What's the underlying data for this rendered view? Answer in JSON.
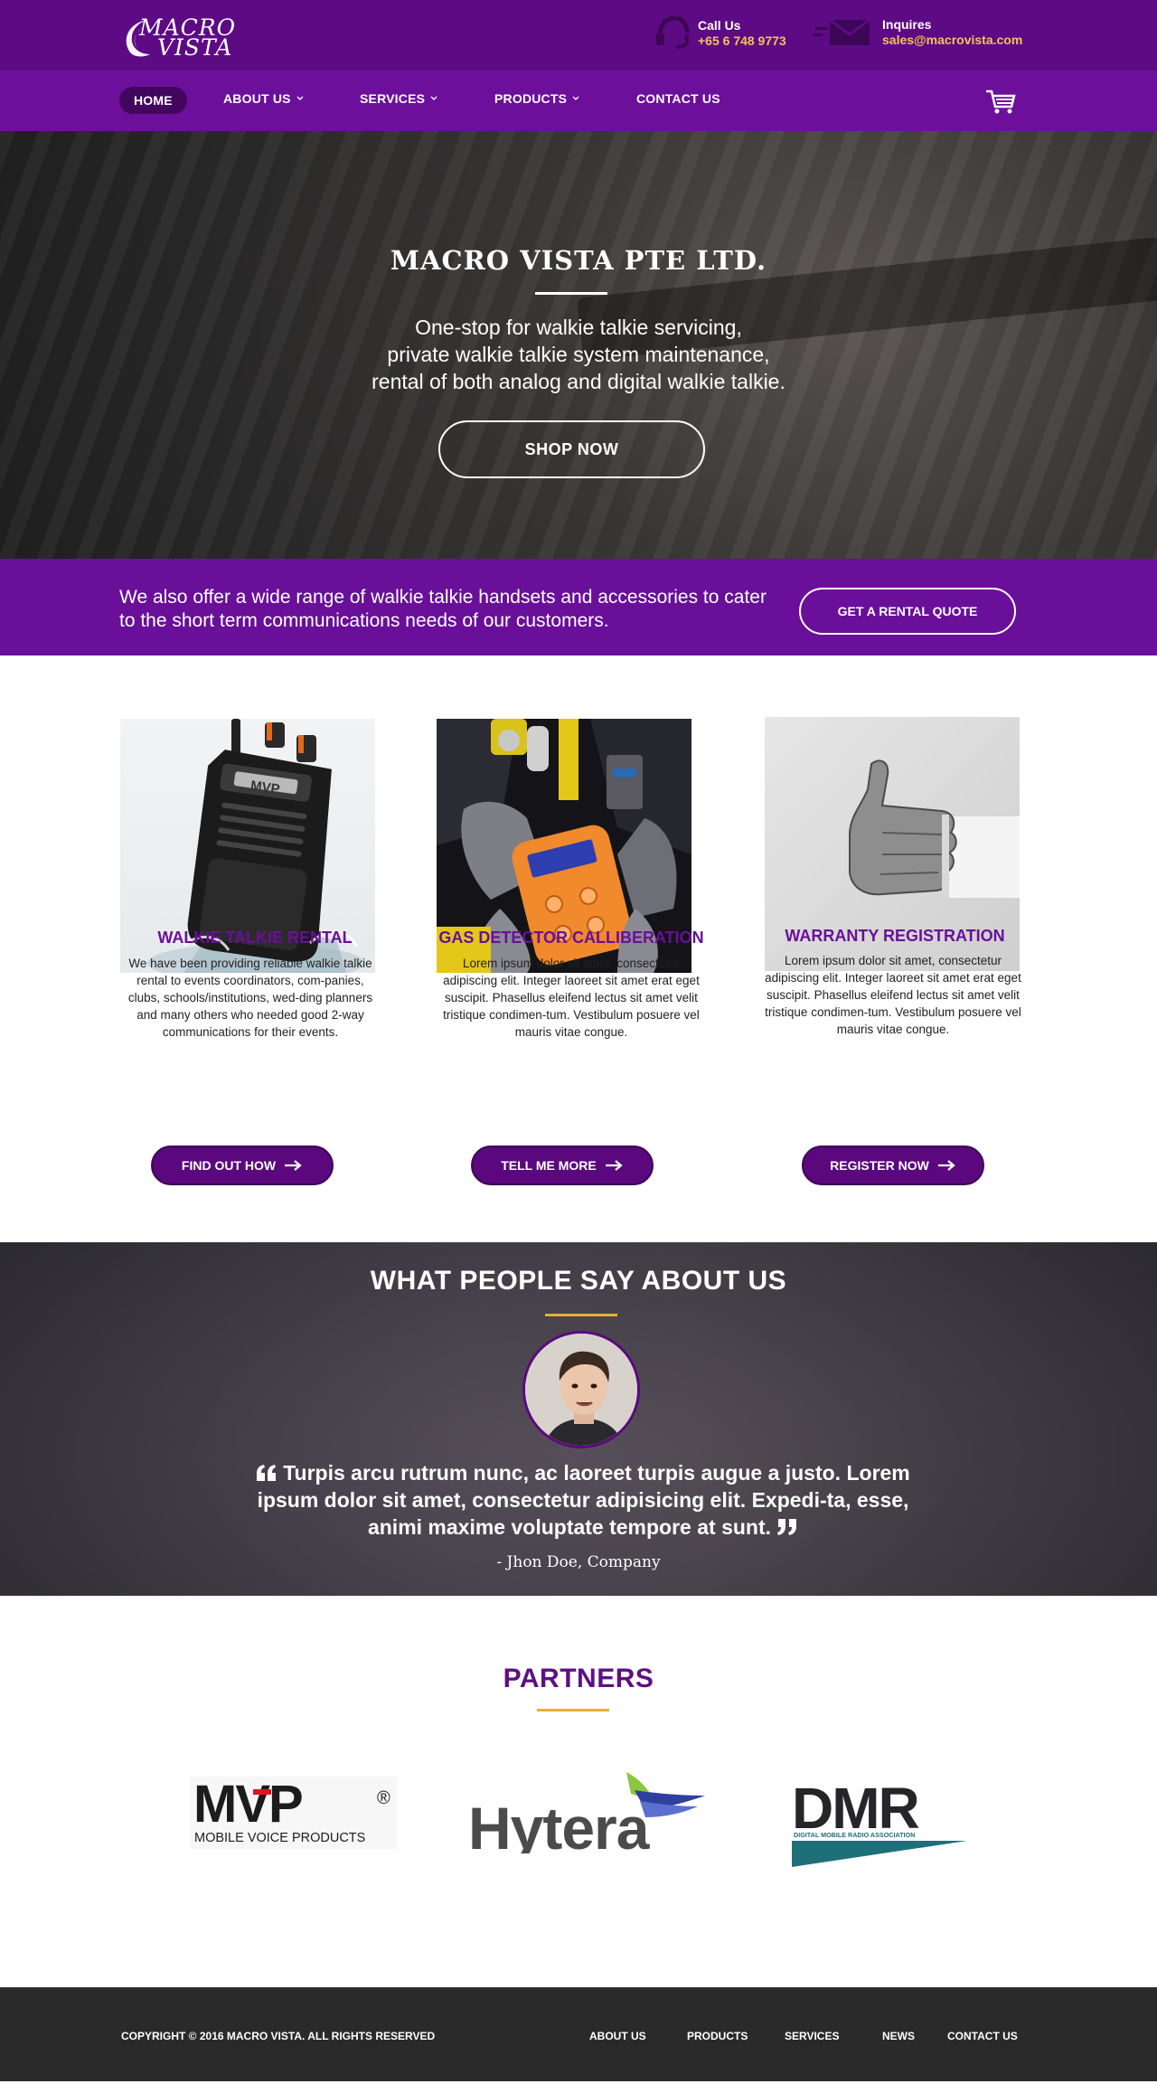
{
  "brand": {
    "line1": "MACRO",
    "line2": "VISTA"
  },
  "contact": {
    "call_label": "Call Us",
    "call_value": "+65 6 748 9773",
    "mail_label": "Inquires",
    "mail_value": "sales@macrovista.com"
  },
  "nav": {
    "home": "HOME",
    "about": "ABOUT US",
    "services": "SERVICES",
    "products": "PRODUCTS",
    "contact": "CONTACT US"
  },
  "hero": {
    "title": "MACRO VISTA PTE LTD.",
    "tagline_1": "One-stop for walkie talkie servicing,",
    "tagline_2": "private walkie talkie system maintenance,",
    "tagline_3": "rental of both analog and digital walkie talkie.",
    "cta": "SHOP NOW"
  },
  "promo": {
    "text": "We also offer a wide range of walkie talkie handsets and accessories to cater to the short term communications needs of our customers.",
    "cta": "GET A RENTAL QUOTE"
  },
  "services": [
    {
      "title": "WALKIE TALKIE RENTAL",
      "desc": "We have been providing reliable walkie talkie rental to events coordinators, com-panies, clubs, schools/institutions, wed-ding planners and many others who needed good 2-way communications for their events.",
      "cta": "FIND OUT HOW",
      "radio_label": "MVP"
    },
    {
      "title": "GAS DETECTOR CALLIBERATION",
      "desc": "Lorem ipsum dolor sit amet, consectetur adipiscing elit. Integer laoreet sit amet erat eget suscipit. Phasellus eleifend lectus sit amet velit tristique condimen-tum. Vestibulum posuere vel mauris vitae congue.",
      "cta": "TELL ME MORE"
    },
    {
      "title": "WARRANTY REGISTRATION",
      "desc": "Lorem ipsum dolor sit amet, consectetur adipiscing elit. Integer laoreet sit amet erat eget suscipit. Phasellus eleifend lectus sit amet velit tristique condimen-tum. Vestibulum posuere vel mauris vitae congue.",
      "cta": "REGISTER NOW"
    }
  ],
  "testimonials": {
    "heading": "WHAT PEOPLE SAY ABOUT US",
    "quote": "Turpis arcu rutrum nunc, ac laoreet turpis augue a justo. Lorem ipsum dolor sit amet, consectetur adipisicing elit. Expedi-ta, esse, animi maxime voluptate tempore at sunt.",
    "author": "- Jhon Doe, Company"
  },
  "partners": {
    "heading": "PARTNERS",
    "mvp_mark": "MVP",
    "mvp_sub": "MOBILE VOICE PRODUCTS",
    "mvp_reg": "®",
    "hytera": "Hytera",
    "dmr_mark": "DMR",
    "dmr_sub": "DIGITAL MOBILE RADIO ASSOCIATION"
  },
  "footer": {
    "copyright": "COPYRIGHT © 2016 MACRO VISTA. ALL RIGHTS RESERVED",
    "links": [
      "ABOUT US",
      "PRODUCTS",
      "SERVICES",
      "NEWS",
      "CONTACT US"
    ]
  },
  "colors": {
    "topbar": "#5d0b84",
    "nav": "#6c0f9b",
    "accent": "#6a0f99",
    "gold": "#e8b030",
    "contact_value": "#f2c35a",
    "footer": "#2a2a2a"
  },
  "icons": [
    "headset-icon",
    "mail-icon",
    "cart-icon",
    "chevron-down-icon",
    "arrow-right-icon",
    "quote-open-icon",
    "quote-close-icon"
  ]
}
